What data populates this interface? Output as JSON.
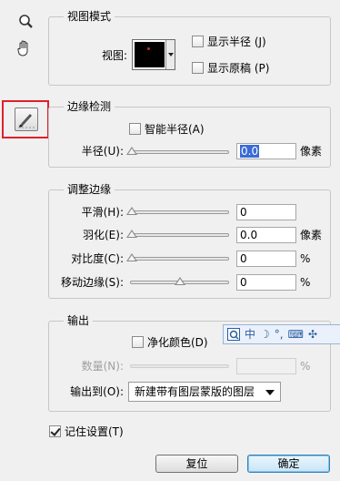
{
  "tools": {
    "zoom_icon": "magnifier-icon",
    "hand_icon": "hand-icon",
    "refine_icon": "refine-radius-brush-icon"
  },
  "view_mode": {
    "title": "视图模式",
    "view_label": "视图:",
    "show_radius": "显示半径 (J)",
    "show_original": "显示原稿 (P)"
  },
  "edge_detection": {
    "title": "边缘检测",
    "smart_radius": "智能半径(A)",
    "radius_label": "半径(U):",
    "radius_value": "0.0",
    "radius_unit": "像素"
  },
  "adjust_edge": {
    "title": "调整边缘",
    "rows": [
      {
        "label": "平滑(H):",
        "value": "0",
        "unit": "",
        "level": 0
      },
      {
        "label": "羽化(E):",
        "value": "0.0",
        "unit": "像素",
        "level": 0
      },
      {
        "label": "对比度(C):",
        "value": "0",
        "unit": "%",
        "level": 0
      },
      {
        "label": "移动边缘(S):",
        "value": "0",
        "unit": "%",
        "level": 0.5
      }
    ]
  },
  "output": {
    "title": "输出",
    "decontaminate": "净化颜色(D)",
    "amount_label": "数量(N):",
    "amount_unit": "%",
    "output_to_label": "输出到(O):",
    "output_to_value": "新建带有图层蒙版的图层"
  },
  "ime": {
    "items": [
      "中",
      "☽",
      "°,",
      "⌨",
      "✣"
    ]
  },
  "remember": {
    "label": "记住设置(T)",
    "checked": true
  },
  "buttons": {
    "reset": "复位",
    "ok": "确定"
  },
  "colors": {
    "highlight_frame": "#e0202a",
    "selection": "#3a6bd6"
  }
}
